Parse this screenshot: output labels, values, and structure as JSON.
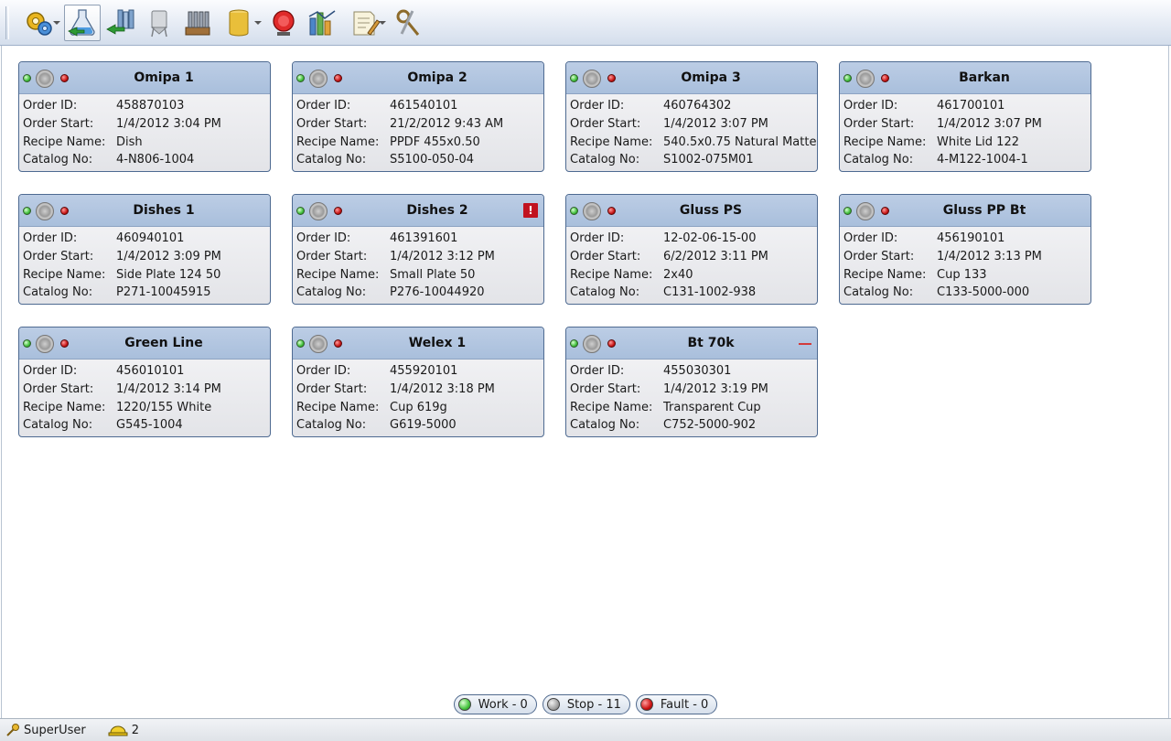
{
  "toolbar": {
    "buttons": [
      {
        "icon": "settings-gears-icon",
        "dropdown": true
      },
      {
        "icon": "lab-flask-icon",
        "active": true
      },
      {
        "icon": "production-transfer-icon"
      },
      {
        "icon": "silo-icon"
      },
      {
        "icon": "material-bins-icon"
      },
      {
        "icon": "barrel-icon",
        "dropdown": true
      },
      {
        "icon": "alarm-bell-icon"
      },
      {
        "icon": "reports-chart-icon"
      },
      {
        "icon": "notes-icon",
        "dropdown": true
      },
      {
        "icon": "tools-key-icon"
      }
    ]
  },
  "labels": {
    "order_id": "Order ID:",
    "order_start": "Order Start:",
    "recipe_name": "Recipe Name:",
    "catalog_no": "Catalog No:"
  },
  "machines": [
    {
      "name": "Omipa 1",
      "order_id": "458870103",
      "order_start": "1/4/2012 3:04 PM",
      "recipe_name": "Dish",
      "catalog_no": "4-N806-1004",
      "indicator": ""
    },
    {
      "name": "Omipa 2",
      "order_id": "461540101",
      "order_start": "21/2/2012 9:43 AM",
      "recipe_name": "PPDF 455x0.50",
      "catalog_no": "S5100-050-04",
      "indicator": ""
    },
    {
      "name": "Omipa 3",
      "order_id": "460764302",
      "order_start": "1/4/2012 3:07 PM",
      "recipe_name": "540.5x0.75 Natural Matte",
      "catalog_no": "S1002-075M01",
      "indicator": ""
    },
    {
      "name": "Barkan",
      "order_id": "461700101",
      "order_start": "1/4/2012 3:07 PM",
      "recipe_name": "White Lid 122",
      "catalog_no": "4-M122-1004-1",
      "indicator": ""
    },
    {
      "name": "Dishes 1",
      "order_id": "460940101",
      "order_start": "1/4/2012 3:09 PM",
      "recipe_name": "Side Plate 124 50",
      "catalog_no": "P271-10045915",
      "indicator": ""
    },
    {
      "name": "Dishes 2",
      "order_id": "461391601",
      "order_start": "1/4/2012 3:12 PM",
      "recipe_name": "Small Plate 50",
      "catalog_no": "P276-10044920",
      "indicator": "alert",
      "indicator_text": "!"
    },
    {
      "name": "Gluss PS",
      "order_id": "12-02-06-15-00",
      "order_start": "6/2/2012 3:11 PM",
      "recipe_name": "2x40",
      "catalog_no": "C131-1002-938",
      "indicator": ""
    },
    {
      "name": "Gluss PP Bt",
      "order_id": "456190101",
      "order_start": "1/4/2012 3:13 PM",
      "recipe_name": "Cup 133",
      "catalog_no": "C133-5000-000",
      "indicator": ""
    },
    {
      "name": "Green Line",
      "order_id": "456010101",
      "order_start": "1/4/2012 3:14 PM",
      "recipe_name": "1220/155 White",
      "catalog_no": "G545-1004",
      "indicator": ""
    },
    {
      "name": "Welex 1",
      "order_id": "455920101",
      "order_start": "1/4/2012 3:18 PM",
      "recipe_name": "Cup 619g",
      "catalog_no": "G619-5000",
      "indicator": ""
    },
    {
      "name": "Bt 70k",
      "order_id": "455030301",
      "order_start": "1/4/2012 3:19 PM",
      "recipe_name": "Transparent Cup",
      "catalog_no": "C752-5000-902",
      "indicator": "dash"
    }
  ],
  "legend": {
    "work": "Work - 0",
    "stop": "Stop - 11",
    "fault": "Fault - 0"
  },
  "statusbar": {
    "user": "SuperUser",
    "count": "2"
  },
  "colors": {
    "card_header": "#b3c6e1",
    "card_border": "#4e6a91",
    "work": "#46c53f",
    "stop": "#a3a3a3",
    "fault": "#cc1212"
  }
}
